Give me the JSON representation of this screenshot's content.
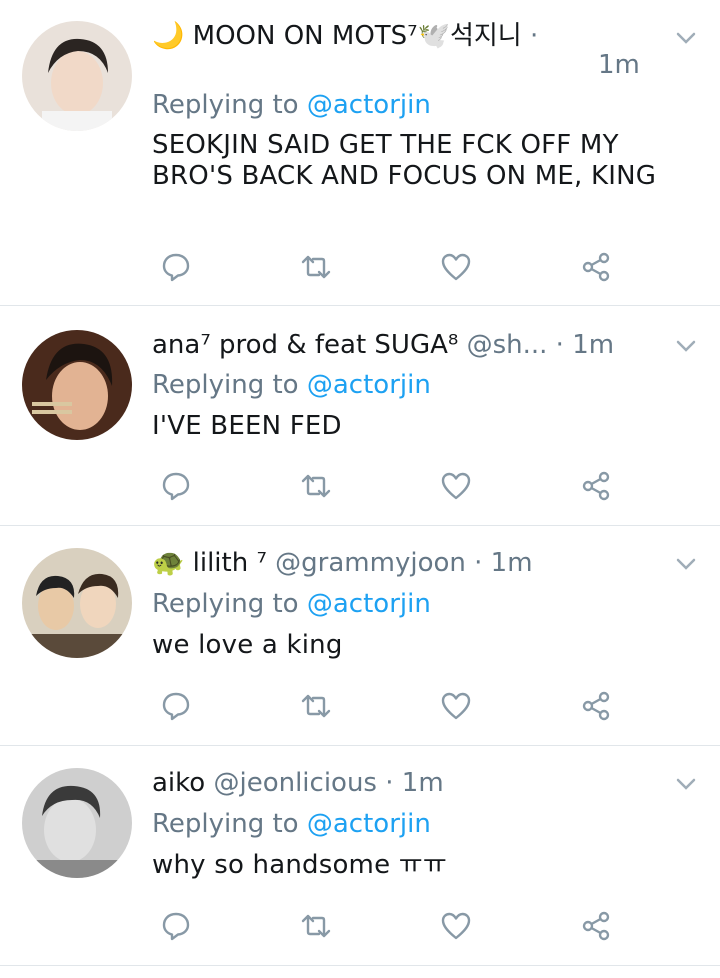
{
  "tweets": [
    {
      "display_name": "🌙 MOON ON MOTS⁷🕊️석지니",
      "handle": "",
      "sep": " ·",
      "time": "1m",
      "replying_prefix": "Replying to ",
      "replying_handle": "@actorjin",
      "text": "SEOKJIN SAID GET THE FCK OFF MY BRO'S BACK AND FOCUS ON ME, KING",
      "avatar_color": "#d8c8bd"
    },
    {
      "display_name": "ana⁷ prod & feat SUGA⁸",
      "handle": "@sh...",
      "sep": " · ",
      "time": "1m",
      "replying_prefix": "Replying to ",
      "replying_handle": "@actorjin",
      "text": "I'VE BEEN FED",
      "avatar_color": "#6b3f2a"
    },
    {
      "display_name": "🐢 lilith ⁷",
      "handle": "@grammyjoon",
      "sep": " · ",
      "time": "1m",
      "replying_prefix": "Replying to ",
      "replying_handle": "@actorjin",
      "text": "we love a king",
      "avatar_color": "#c7bba6"
    },
    {
      "display_name": "aiko",
      "handle": "@jeonlicious",
      "sep": " · ",
      "time": "1m",
      "replying_prefix": "Replying to ",
      "replying_handle": "@actorjin",
      "text": "why so handsome ㅠㅠ",
      "avatar_color": "#bdbdbd"
    }
  ],
  "icons": {
    "reply": "reply-icon",
    "retweet": "retweet-icon",
    "like": "heart-icon",
    "share": "share-icon",
    "more": "chevron-down-icon"
  },
  "colors": {
    "link": "#1da1f2",
    "meta": "#657786",
    "text": "#14171a",
    "divider": "#e1e6ea"
  }
}
